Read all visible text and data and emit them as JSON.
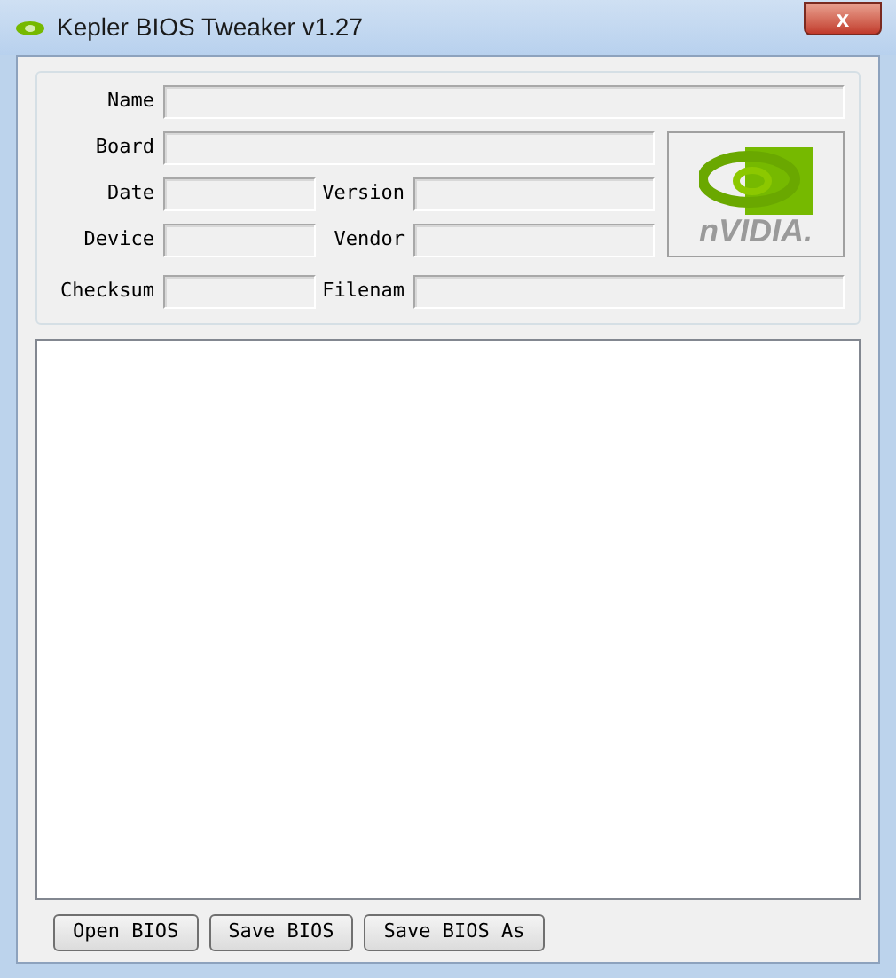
{
  "window": {
    "title": "Kepler BIOS Tweaker v1.27",
    "close": "x"
  },
  "fields": [
    {
      "label": "Name",
      "kind": "full"
    },
    {
      "label": "Board",
      "kind": "wide"
    },
    {
      "label": "Date",
      "kind": "half"
    },
    {
      "label": "Version",
      "kind": "half"
    },
    {
      "label": "Device",
      "kind": "half"
    },
    {
      "label": "Vendor",
      "kind": "half"
    },
    {
      "label": "Checksum",
      "kind": "half"
    },
    {
      "label": "Filenam",
      "kind": "half"
    }
  ],
  "logo": {
    "text": "nVIDIA."
  },
  "buttons": [
    "Open BIOS",
    "Save BIOS",
    "Save BIOS As"
  ]
}
